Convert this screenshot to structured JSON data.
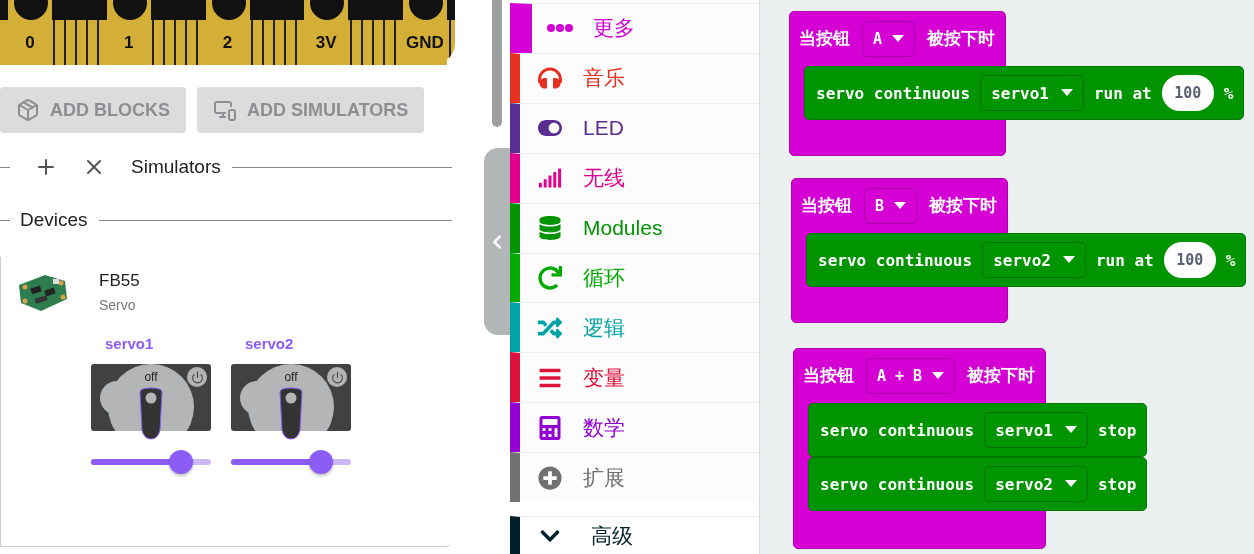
{
  "board": {
    "pins": [
      "0",
      "1",
      "2",
      "3V",
      "GND"
    ]
  },
  "buttons": [
    {
      "label": "ADD BLOCKS",
      "disabled": true
    },
    {
      "label": "ADD SIMULATORS",
      "disabled": true
    }
  ],
  "simulators_header": {
    "title": "Simulators"
  },
  "devices_header": {
    "title": "Devices"
  },
  "device": {
    "name": "FB55",
    "type": "Servo",
    "servos": [
      {
        "label": "servo1",
        "state": "off",
        "level": 0.75
      },
      {
        "label": "servo2",
        "state": "off",
        "level": 0.75
      }
    ]
  },
  "toolbox": {
    "categories": [
      {
        "label": "更多",
        "color": "#d400d4",
        "selected": true
      },
      {
        "label": "音乐",
        "color": "#e63022",
        "selected": false
      },
      {
        "label": "LED",
        "color": "#5c2d91",
        "selected": false
      },
      {
        "label": "无线",
        "color": "#e3008c",
        "selected": false
      },
      {
        "label": "Modules",
        "color": "#009400",
        "selected": false
      },
      {
        "label": "循环",
        "color": "#00aa00",
        "selected": false
      },
      {
        "label": "逻辑",
        "color": "#00a4a6",
        "selected": false
      },
      {
        "label": "变量",
        "color": "#dc143c",
        "selected": false
      },
      {
        "label": "数学",
        "color": "#9400d3",
        "selected": false
      },
      {
        "label": "扩展",
        "color": "#717171",
        "selected": false
      }
    ],
    "advanced": {
      "label": "高级",
      "expanded": false
    }
  },
  "workspace": {
    "blocks": [
      {
        "label": "当按钮",
        "button": "A",
        "suffix": "被按下时",
        "statements": [
          {
            "kind": "run",
            "name": "servo continuous",
            "servo": "servo1",
            "action": "run at",
            "value": "100",
            "unit": "%"
          }
        ]
      },
      {
        "label": "当按钮",
        "button": "B",
        "suffix": "被按下时",
        "statements": [
          {
            "kind": "run",
            "name": "servo continuous",
            "servo": "servo2",
            "action": "run at",
            "value": "100",
            "unit": "%"
          }
        ]
      },
      {
        "label": "当按钮",
        "button": "A + B",
        "suffix": "被按下时",
        "statements": [
          {
            "kind": "stop",
            "name": "servo continuous",
            "servo": "servo1",
            "action": "stop"
          },
          {
            "kind": "stop",
            "name": "servo continuous",
            "servo": "servo2",
            "action": "stop"
          }
        ]
      }
    ]
  }
}
